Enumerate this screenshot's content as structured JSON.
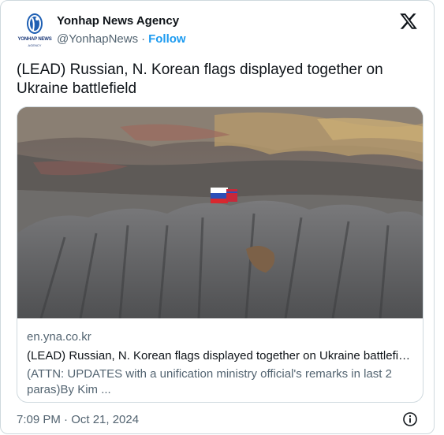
{
  "account": {
    "name": "Yonhap News Agency",
    "handle": "@YonhapNews",
    "separator": "·",
    "follow_label": "Follow",
    "avatar_caption": "YONHAP NEWS",
    "avatar_subcaption": "AGENCY"
  },
  "tweet": {
    "text": "(LEAD) Russian, N. Korean flags displayed together on Ukraine battlefield"
  },
  "link_card": {
    "domain": "en.yna.co.kr",
    "title": "(LEAD) Russian, N. Korean flags displayed together on Ukraine battlefiel...",
    "description": "(ATTN: UPDATES with a unification ministry official's remarks in last 2 paras)By Kim ..."
  },
  "footer": {
    "timestamp": "7:09 PM · Oct 21, 2024"
  },
  "icons": {
    "logo": "x-logo-icon",
    "info": "info-icon",
    "avatar": "yonhap-logo-icon"
  },
  "colors": {
    "accent": "#1d9bf0",
    "secondary_text": "#536471",
    "primary_text": "#0f1419",
    "border": "#cfd9de"
  }
}
